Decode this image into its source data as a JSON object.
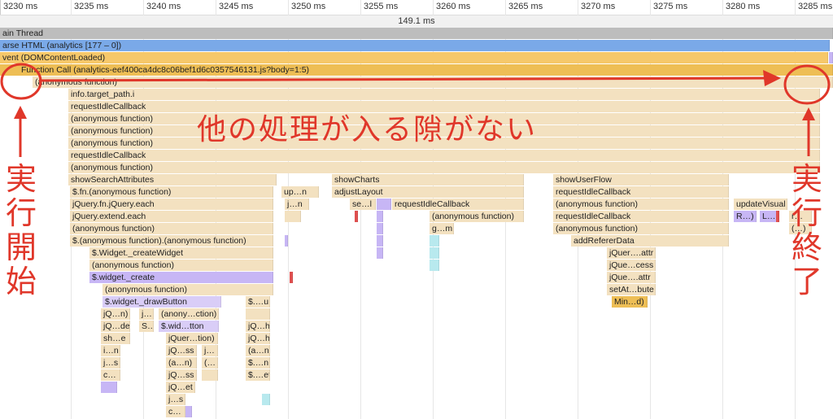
{
  "ruler": {
    "ticks": [
      "3230 ms",
      "3235 ms",
      "3240 ms",
      "3245 ms",
      "3250 ms",
      "3255 ms",
      "3260 ms",
      "3265 ms",
      "3270 ms",
      "3275 ms",
      "3280 ms",
      "3285 ms"
    ],
    "duration": "149.1 ms"
  },
  "tracks": {
    "main_thread": "ain Thread",
    "parse_html": "arse HTML (analytics [177 – 0])",
    "event": "vent (DOMContentLoaded)",
    "function_call": "Function Call (analytics-eef400ca4dc8c06bef1d6c0357546131.js?body=1:5)"
  },
  "frames": {
    "anon_top": "(anonymous function)",
    "info_target": "info.target_path.i",
    "ric1": "requestIdleCallback",
    "anon1": "(anonymous function)",
    "anon2": "(anonymous function)",
    "anon3": "(anonymous function)",
    "ric2": "requestIdleCallback",
    "anon4": "(anonymous function)",
    "show_search": "showSearchAttributes",
    "fn_anon": "$.fn.(anonymous function)",
    "jq_each": "jQuery.fn.jQuery.each",
    "jq_extend": "jQuery.extend.each",
    "anon5": "(anonymous function)",
    "anon_anon": "$.(anonymous function).(anonymous function)",
    "widget_create_widget": "$.Widget._createWidget",
    "anon6": "(anonymous function)",
    "widget_create": "$.widget._create",
    "anon7": "(anonymous function)",
    "draw_button": "$.widget._drawButton",
    "jq_n": "jQ…n)",
    "j_dot": "j…",
    "anon_ction": "(anony…ction)",
    "jq_de": "jQ…de",
    "s_dot": "S…",
    "wid_tton": "$.wid…tton",
    "sh_e": "sh…e",
    "jquer_tion": "jQuer…tion)",
    "i_n": "i…n",
    "jq_ss": "jQ…ss",
    "j_dot2": "j…",
    "j_s": "j…s",
    "a_n": "(a…n)",
    "paren_dot": "(…",
    "c_dot": "c…",
    "a_n2": "(a…n)",
    "jq_ss2": "jQ…ss",
    "jq_et": "jQ…et",
    "j_s2": "j…s",
    "c_dot2": "c…",
    "s_u": "$.…u",
    "jq_h": "jQ…h",
    "jq_h2": "jQ…h",
    "s_n": "$.…n",
    "s_et": "$.…et",
    "up_n": "up…n",
    "j_n": "j…n",
    "show_charts": "showCharts",
    "adjust_layout": "adjustLayout",
    "se_l": "se…l",
    "ric3": "requestIdleCallback",
    "anon8": "(anonymous function)",
    "g_m": "g…m",
    "show_user_flow": "showUserFlow",
    "ric4": "requestIdleCallback",
    "anon9": "(anonymous function)",
    "ric5": "requestIdleCallback",
    "anon10": "(anonymous function)",
    "add_referer": "addRefererData",
    "jquer_attr": "jQuer….attr",
    "jque_cess": "jQue…cess",
    "jque_attr": "jQue….attr",
    "setat_bute": "setAt…bute",
    "min_d": "Min…d)",
    "update_visual": "updateVisual",
    "r_dot": "R…)",
    "l_dot": "L…",
    "r_dot2": "r…",
    "paren2": "(…)"
  },
  "annotations": {
    "no_gap": "他の処理が入る隙がない",
    "start": [
      "実",
      "行",
      "開",
      "始"
    ],
    "end": [
      "実",
      "行",
      "終",
      "了"
    ]
  },
  "colors": {
    "annotation_red": "#e0372a",
    "frame_tan": "#f3e1c0",
    "function_call_gold": "#eebe55",
    "parse_blue": "#7aa9e8"
  }
}
